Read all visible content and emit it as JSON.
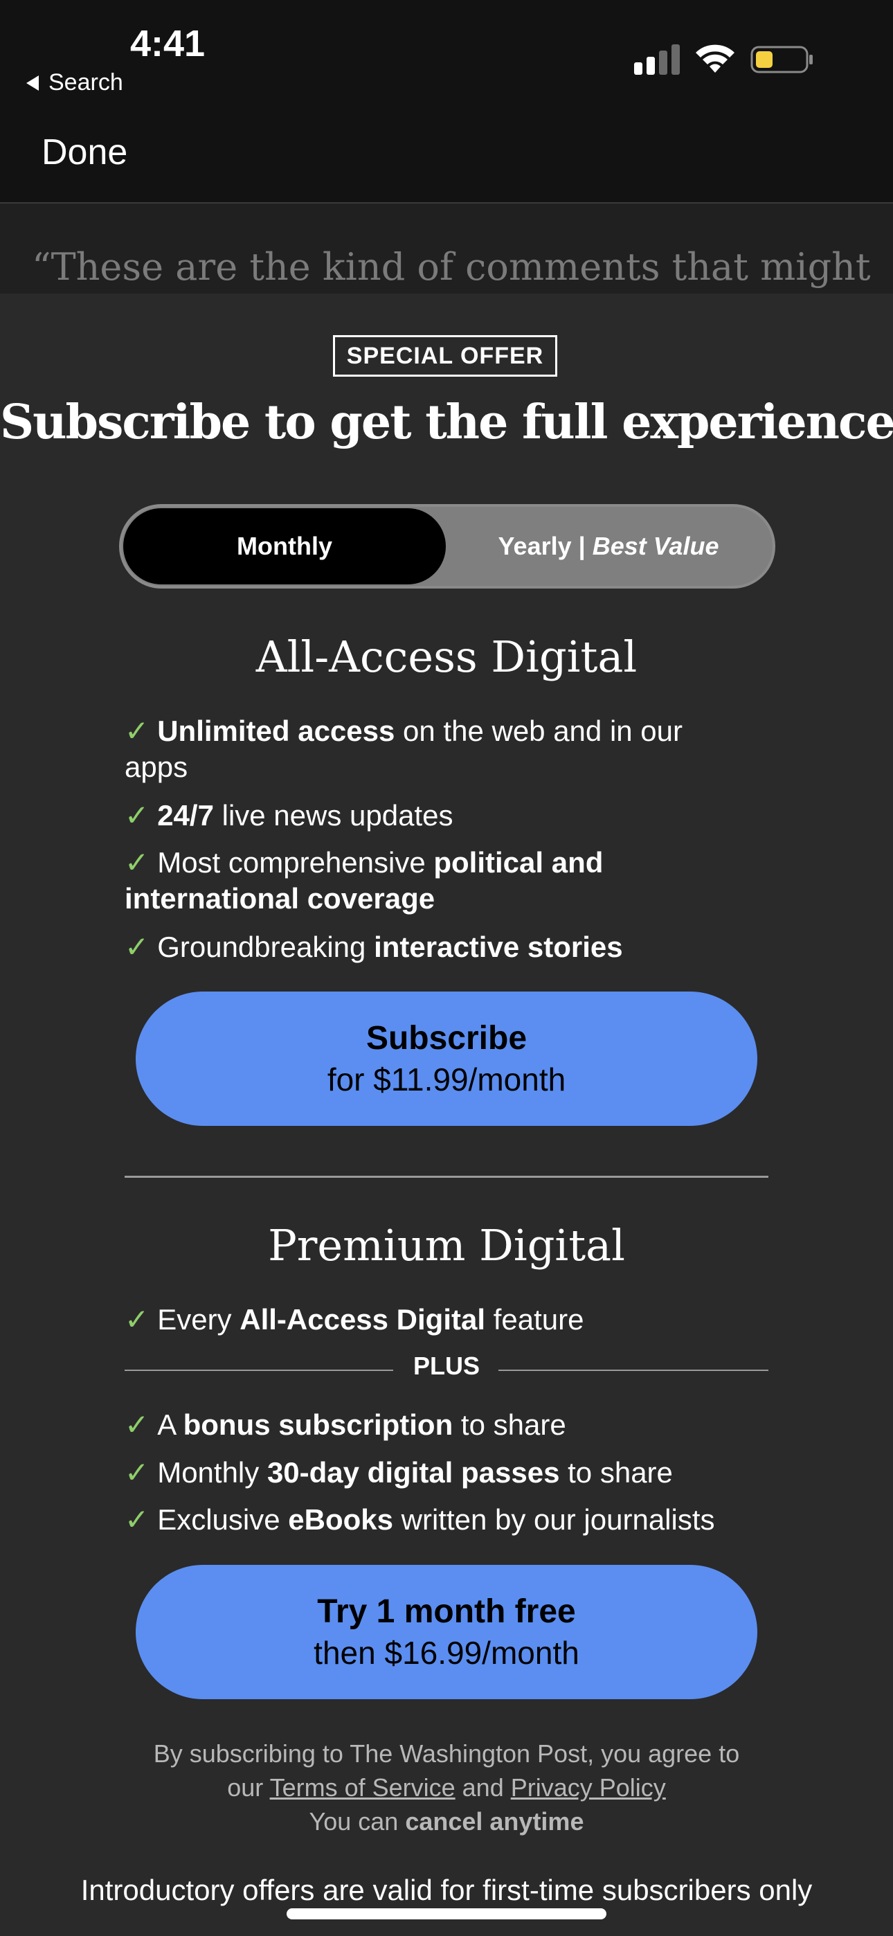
{
  "status": {
    "time": "4:41",
    "back_label": "Search",
    "battery_color": "#f5d142"
  },
  "nav": {
    "done_label": "Done"
  },
  "article_preview": "“These are the kind of comments that might",
  "offer": {
    "badge": "SPECIAL OFFER",
    "headline": "Subscribe to get the full experience.",
    "toggle": {
      "monthly": "Monthly",
      "yearly": "Yearly |",
      "yearly_note": "Best Value",
      "selected": "Monthly"
    }
  },
  "check_glyph": "✓",
  "plans": [
    {
      "title": "All-Access Digital",
      "features": [
        {
          "bold": "Unlimited access",
          "rest": " on the web and in our apps"
        },
        {
          "bold": "24/7",
          "rest": " live news updates"
        },
        {
          "pre": "Most comprehensive ",
          "bold": "political and international coverage"
        },
        {
          "pre": "Groundbreaking ",
          "bold": "interactive stories"
        }
      ],
      "cta_line1": "Subscribe",
      "cta_line2": "for $11.99/month"
    },
    {
      "title": "Premium Digital",
      "features": [
        {
          "pre": "Every ",
          "bold": "All-Access Digital",
          "rest": " feature"
        },
        {
          "pre": "A ",
          "bold": "bonus subscription",
          "rest": " to share"
        },
        {
          "pre": "Monthly ",
          "bold": "30-day digital passes",
          "rest": " to share"
        },
        {
          "pre": "Exclusive ",
          "bold": "eBooks",
          "rest": " written by our journalists"
        }
      ],
      "plus_label": "PLUS",
      "cta_line1": "Try 1 month free",
      "cta_line2": "then $16.99/month"
    }
  ],
  "legal": {
    "line1": "By subscribing to The Washington Post, you agree to",
    "line2_pre": "our ",
    "terms": "Terms of Service",
    "and": " and ",
    "privacy": "Privacy Policy",
    "line3_pre": "You can ",
    "line3_bold": "cancel anytime"
  },
  "intro_note": "Introductory offers are valid for first-time subscribers only",
  "colors": {
    "accent": "#5b8ef0",
    "check": "#8fce6a",
    "sheet": "#2a2a2b",
    "toggle": "#7f7f7f"
  }
}
